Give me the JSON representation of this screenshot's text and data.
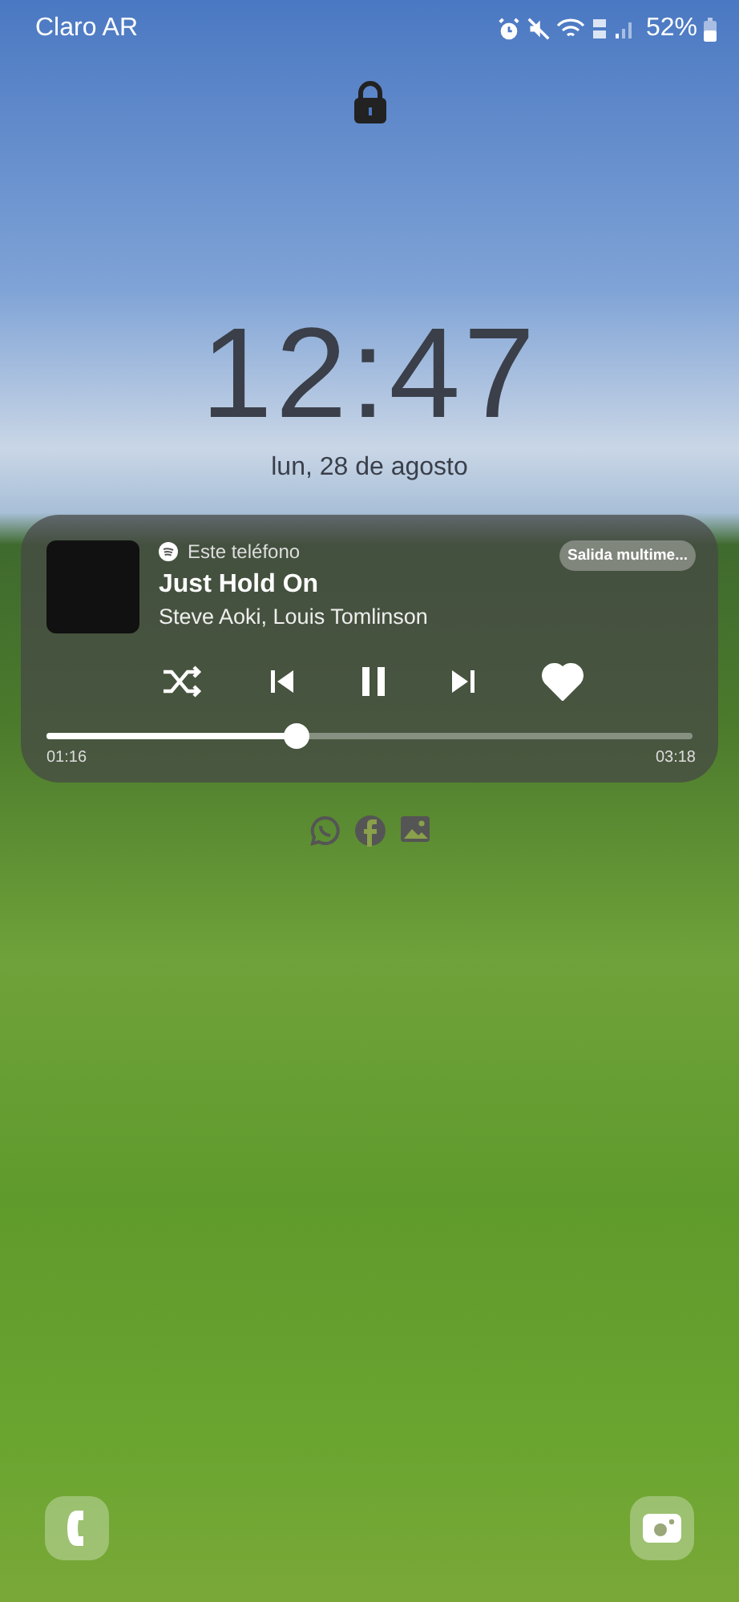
{
  "status_bar": {
    "carrier": "Claro AR",
    "battery": "52%"
  },
  "clock": {
    "time": "12:47",
    "date": "lun, 28 de agosto"
  },
  "media": {
    "source": "Este teléfono",
    "output_button": "Salida multime...",
    "title": "Just Hold On",
    "artist": "Steve Aoki, Louis Tomlinson",
    "playing": true,
    "liked": true,
    "level": 0.386,
    "elapsed": "01:16",
    "total": "03:18"
  },
  "notification_icons": [
    {
      "kind": "chat"
    },
    {
      "kind": "social"
    },
    {
      "kind": "gallery"
    }
  ]
}
